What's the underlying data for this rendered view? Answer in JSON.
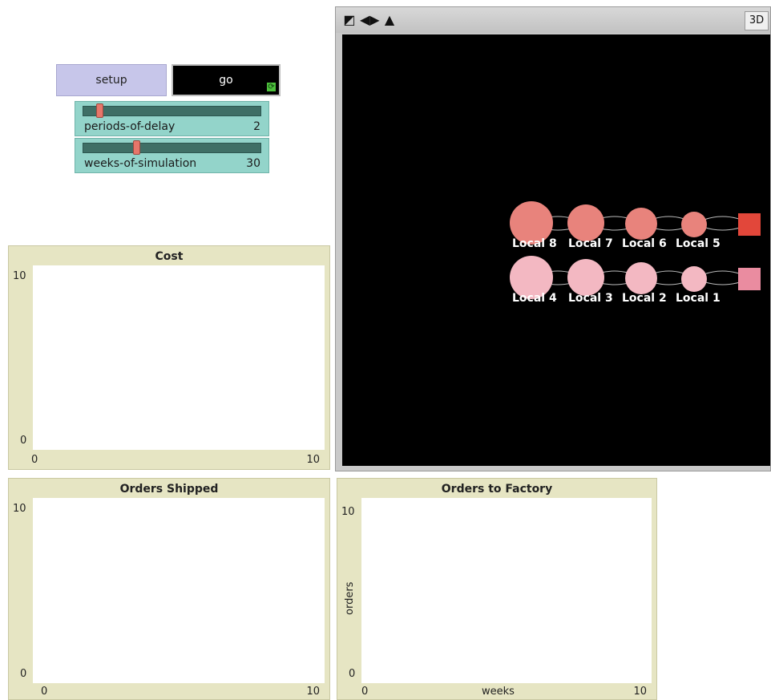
{
  "controls": {
    "setup_label": "setup",
    "go_label": "go",
    "sliders": [
      {
        "name": "periods-of-delay",
        "value": "2"
      },
      {
        "name": "weeks-of-simulation",
        "value": "30"
      }
    ]
  },
  "world": {
    "toolbar_3d": "3D",
    "agents": [
      {
        "label": "Local 8",
        "color": "#e8837c"
      },
      {
        "label": "Local 7",
        "color": "#e8837c"
      },
      {
        "label": "Local 6",
        "color": "#e8837c"
      },
      {
        "label": "Local 5",
        "color": "#e8837c"
      },
      {
        "label": "Local 4",
        "color": "#f3b8c2"
      },
      {
        "label": "Local 3",
        "color": "#f3b8c2"
      },
      {
        "label": "Local 2",
        "color": "#f3b8c2"
      },
      {
        "label": "Local 1",
        "color": "#f3b8c2"
      }
    ],
    "factory_colors": [
      "#e2473a",
      "#ea8ca0"
    ]
  },
  "plots": {
    "cost": {
      "title": "Cost",
      "y_max": "10",
      "y_min": "0",
      "x_min": "0",
      "x_max": "10",
      "xlabel": "",
      "ylabel": ""
    },
    "orders_shipped": {
      "title": "Orders Shipped",
      "y_max": "10",
      "y_min": "0",
      "x_min": "0",
      "x_max": "10",
      "xlabel": "",
      "ylabel": ""
    },
    "orders_to_factory": {
      "title": "Orders to Factory",
      "y_max": "10",
      "y_min": "0",
      "x_min": "0",
      "x_max": "10",
      "xlabel": "weeks",
      "ylabel": "orders"
    }
  }
}
